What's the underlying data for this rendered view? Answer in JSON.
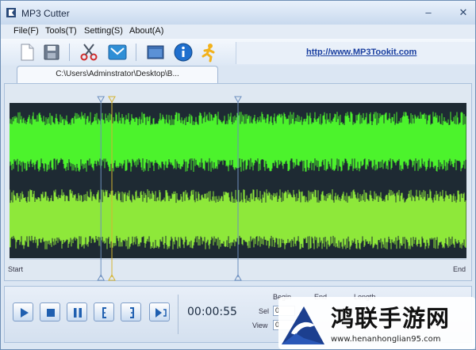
{
  "window": {
    "title": "MP3 Cutter"
  },
  "menu": [
    {
      "label": "File(F)"
    },
    {
      "label": "Tools(T)"
    },
    {
      "label": "Setting(S)"
    },
    {
      "label": "About(A)"
    }
  ],
  "toolbar": {
    "icons": [
      "new-file-icon",
      "save-icon",
      "scissors-icon",
      "email-icon",
      "window-icon",
      "info-icon",
      "runner-icon"
    ],
    "url": "http://www.MP3Tookit.com"
  },
  "tab": {
    "label": "C:\\Users\\Adminstrator\\Desktop\\B..."
  },
  "waveform": {
    "channel_colors": [
      "#4cf32c",
      "#8ee83a"
    ],
    "background": "#1e2a33",
    "markers": [
      {
        "name": "selection-start-marker",
        "color": "#6d8fbf",
        "position": 0.2
      },
      {
        "name": "playhead-marker",
        "color": "#d6b433",
        "position": 0.224
      },
      {
        "name": "selection-end-marker",
        "color": "#6d8fbf",
        "position": 0.5
      }
    ],
    "ruler_start": "Start",
    "ruler_end": "End"
  },
  "controls": {
    "buttons": [
      "play-icon",
      "stop-icon",
      "pause-icon",
      "set-begin-icon",
      "set-end-icon",
      "play-selection-icon"
    ],
    "time": "00:00:55",
    "columns": [
      "Begin",
      "End",
      "Length"
    ],
    "rows": [
      "Sel",
      "View"
    ],
    "sel_begin": "0",
    "view_begin": "0"
  },
  "watermark": {
    "text": "鸿联手游网",
    "url": "www.henanhonglian95.com"
  }
}
